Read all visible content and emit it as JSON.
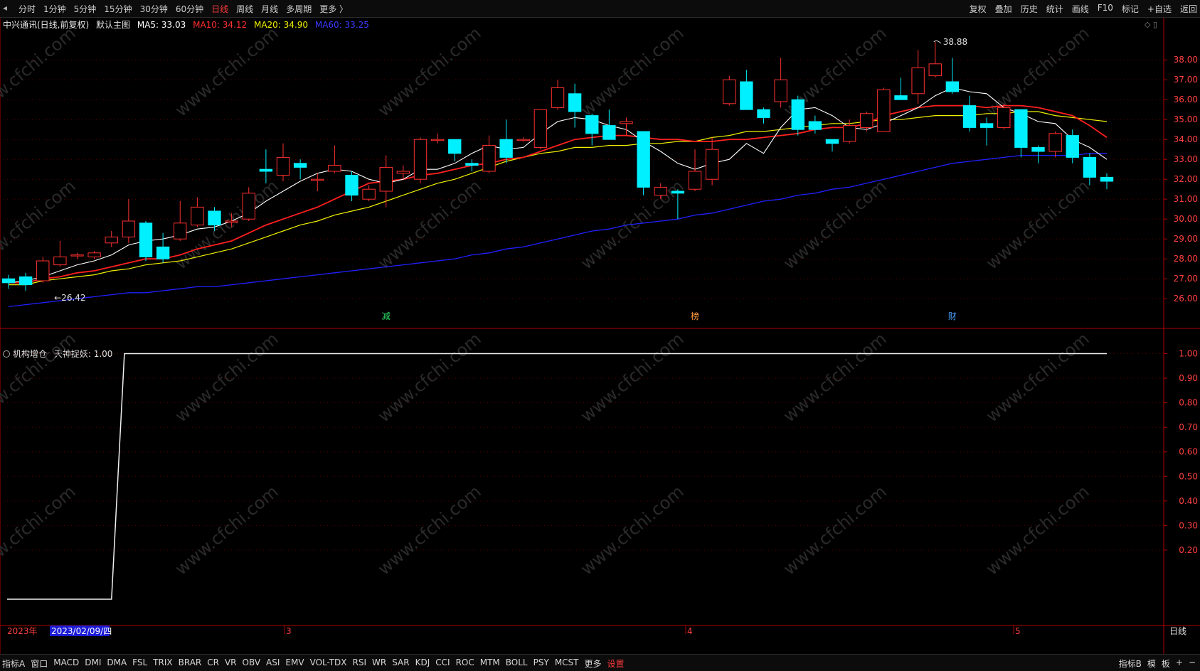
{
  "topbar": {
    "nav_arrow": "◂",
    "periods": [
      "分时",
      "1分钟",
      "5分钟",
      "15分钟",
      "30分钟",
      "60分钟",
      "日线",
      "周线",
      "月线",
      "多周期",
      "更多 〉"
    ],
    "active_period": "日线",
    "tools": [
      "复权",
      "叠加",
      "历史",
      "统计",
      "画线",
      "F10",
      "标记",
      "+自选",
      "返回"
    ]
  },
  "main_chart": {
    "stock_name": "中兴通讯(日线,前复权)",
    "template": "默认主图",
    "ma5_label": "MA5: 33.03",
    "ma10_label": "MA10: 34.12",
    "ma20_label": "MA20: 34.90",
    "ma60_label": "MA60: 33.25",
    "panel_icons": "◇ ▯",
    "high_annotation": "38.88",
    "low_annotation": "←26.42",
    "price_ticks": [
      "38.00",
      "37.00",
      "36.00",
      "35.00",
      "34.00",
      "33.00",
      "32.00",
      "31.00",
      "30.00",
      "29.00",
      "28.00",
      "27.00",
      "26.00"
    ],
    "markers": [
      {
        "text": "减",
        "color": "#2ee86a"
      },
      {
        "text": "榜",
        "color": "#ff9a3c"
      },
      {
        "text": "财",
        "color": "#4aa3ff"
      }
    ],
    "watermark": "www.cfchi.com",
    "colors": {
      "up": "#ff3030",
      "down": "#00f0ff",
      "ma5": "#ffffff",
      "ma10": "#ff2020",
      "ma20": "#f0f000",
      "ma60": "#2020ff",
      "axis": "#b00000"
    }
  },
  "sub_chart": {
    "name": "机构增仓",
    "indicator_label": "天神捉妖: 1.00",
    "ticks": [
      "1.00",
      "0.90",
      "0.80",
      "0.70",
      "0.60",
      "0.50",
      "0.40",
      "0.30",
      "0.20"
    ]
  },
  "date_axis": {
    "year_label": "2023年",
    "cursor_date": "2023/02/09/四",
    "month_labels": [
      "3",
      "4",
      "5"
    ],
    "period_badge": "日线"
  },
  "bottombar": {
    "indicators": [
      "指标A",
      "窗口",
      "MACD",
      "DMI",
      "DMA",
      "FSL",
      "TRIX",
      "BRAR",
      "CR",
      "VR",
      "OBV",
      "ASI",
      "EMV",
      "VOL-TDX",
      "RSI",
      "WR",
      "SAR",
      "KDJ",
      "CCI",
      "ROC",
      "MTM",
      "BOLL",
      "PSY",
      "MCST",
      "更多",
      "设置"
    ],
    "right_buttons": [
      "指标B",
      "模",
      "板",
      "+",
      "−"
    ]
  },
  "chart_data": {
    "type": "candlestick",
    "candles": [
      [
        27.0,
        26.8,
        27.2,
        26.5
      ],
      [
        27.1,
        26.7,
        27.3,
        26.4
      ],
      [
        26.9,
        27.9,
        28.1,
        26.8
      ],
      [
        27.7,
        28.1,
        28.9,
        27.6
      ],
      [
        28.2,
        28.2,
        28.3,
        28.0
      ],
      [
        28.1,
        28.3,
        28.4,
        28.0
      ],
      [
        28.8,
        29.1,
        29.4,
        28.6
      ],
      [
        29.1,
        29.9,
        31.0,
        28.8
      ],
      [
        29.8,
        28.1,
        29.9,
        27.9
      ],
      [
        28.6,
        28.0,
        29.3,
        27.8
      ],
      [
        29.0,
        29.8,
        30.9,
        28.9
      ],
      [
        29.7,
        30.6,
        31.1,
        29.6
      ],
      [
        30.4,
        29.7,
        30.6,
        29.4
      ],
      [
        29.9,
        29.9,
        30.3,
        29.6
      ],
      [
        30.0,
        31.3,
        31.6,
        29.9
      ],
      [
        32.5,
        32.4,
        33.5,
        31.8
      ],
      [
        32.2,
        33.1,
        33.8,
        31.9
      ],
      [
        32.8,
        32.6,
        33.0,
        32.0
      ],
      [
        32.0,
        32.0,
        32.3,
        31.4
      ],
      [
        32.4,
        32.7,
        33.7,
        32.3
      ],
      [
        32.2,
        31.2,
        32.4,
        30.9
      ],
      [
        31.0,
        31.5,
        31.7,
        30.9
      ],
      [
        31.4,
        32.6,
        33.2,
        30.6
      ],
      [
        32.3,
        32.4,
        32.7,
        32.0
      ],
      [
        32.0,
        34.0,
        34.1,
        31.8
      ],
      [
        34.0,
        34.0,
        34.3,
        33.8
      ],
      [
        34.0,
        33.3,
        34.0,
        32.9
      ],
      [
        32.8,
        32.7,
        33.0,
        32.4
      ],
      [
        32.4,
        33.7,
        34.2,
        32.3
      ],
      [
        34.0,
        33.1,
        35.0,
        32.8
      ],
      [
        34.0,
        34.0,
        34.1,
        33.9
      ],
      [
        33.6,
        35.5,
        35.5,
        33.5
      ],
      [
        35.6,
        36.6,
        37.0,
        35.5
      ],
      [
        36.3,
        35.4,
        36.8,
        34.6
      ],
      [
        35.2,
        34.3,
        35.3,
        33.7
      ],
      [
        34.7,
        34.0,
        35.5,
        34.0
      ],
      [
        34.8,
        34.9,
        35.1,
        34.2
      ],
      [
        34.4,
        31.6,
        34.4,
        31.2
      ],
      [
        31.2,
        31.6,
        31.8,
        31.0
      ],
      [
        31.4,
        31.3,
        31.5,
        30.0
      ],
      [
        31.5,
        32.4,
        33.5,
        31.4
      ],
      [
        32.0,
        33.5,
        34.1,
        31.7
      ],
      [
        35.8,
        37.0,
        37.2,
        35.7
      ],
      [
        36.9,
        35.5,
        37.5,
        35.5
      ],
      [
        35.5,
        35.1,
        35.6,
        34.8
      ],
      [
        35.9,
        37.0,
        38.1,
        35.6
      ],
      [
        36.0,
        34.5,
        36.2,
        34.2
      ],
      [
        34.9,
        34.5,
        35.2,
        34.3
      ],
      [
        34.0,
        33.8,
        34.0,
        33.4
      ],
      [
        33.9,
        34.7,
        35.0,
        33.8
      ],
      [
        34.6,
        35.3,
        35.4,
        34.4
      ],
      [
        34.4,
        36.5,
        36.6,
        34.5
      ],
      [
        36.2,
        36.0,
        37.1,
        36.0
      ],
      [
        36.3,
        37.6,
        38.5,
        35.8
      ],
      [
        37.2,
        37.8,
        38.9,
        37.1
      ],
      [
        36.9,
        36.4,
        38.1,
        36.3
      ],
      [
        35.7,
        34.6,
        36.2,
        34.4
      ],
      [
        34.8,
        34.6,
        35.1,
        33.7
      ],
      [
        34.6,
        35.6,
        35.8,
        34.5
      ],
      [
        35.5,
        33.6,
        35.5,
        33.1
      ],
      [
        33.6,
        33.4,
        33.7,
        32.8
      ],
      [
        33.4,
        34.3,
        34.4,
        33.1
      ],
      [
        34.2,
        33.1,
        34.5,
        32.8
      ],
      [
        33.1,
        32.1,
        33.3,
        31.7
      ],
      [
        32.1,
        31.9,
        32.3,
        31.5
      ]
    ],
    "ma5": [
      26.8,
      26.9,
      27.1,
      27.4,
      27.7,
      27.9,
      28.2,
      28.7,
      28.9,
      29.0,
      29.2,
      29.5,
      29.6,
      29.9,
      30.3,
      30.9,
      31.4,
      31.9,
      32.3,
      32.5,
      32.4,
      32.0,
      31.8,
      32.0,
      32.5,
      32.5,
      32.8,
      33.3,
      33.7,
      33.5,
      33.6,
      34.3,
      34.9,
      35.1,
      35.0,
      34.7,
      34.5,
      33.9,
      33.4,
      32.8,
      32.5,
      32.8,
      33.0,
      33.8,
      33.3,
      34.6,
      35.5,
      35.6,
      35.2,
      34.6,
      34.5,
      34.8,
      35.2,
      35.6,
      36.2,
      36.6,
      36.4,
      36.3,
      35.6,
      35.3,
      34.9,
      34.8,
      34.0,
      33.6,
      33.0
    ],
    "ma10": [
      26.8,
      26.8,
      27.0,
      27.1,
      27.3,
      27.4,
      27.6,
      27.8,
      28.0,
      28.0,
      28.2,
      28.5,
      28.7,
      28.9,
      29.3,
      29.7,
      30.0,
      30.3,
      30.6,
      31.0,
      31.4,
      31.8,
      31.9,
      32.0,
      32.2,
      32.3,
      32.5,
      32.7,
      32.8,
      33.0,
      33.1,
      33.4,
      33.7,
      34.0,
      34.1,
      34.2,
      34.2,
      34.1,
      34.0,
      34.0,
      33.9,
      33.9,
      34.0,
      34.0,
      34.1,
      34.2,
      34.3,
      34.5,
      34.6,
      34.6,
      34.8,
      35.2,
      35.4,
      35.6,
      35.7,
      35.7,
      35.7,
      35.6,
      35.7,
      35.7,
      35.6,
      35.4,
      35.2,
      34.7,
      34.1
    ],
    "ma20": [
      26.7,
      26.7,
      26.9,
      27.0,
      27.1,
      27.2,
      27.4,
      27.5,
      27.7,
      27.8,
      27.9,
      28.1,
      28.3,
      28.5,
      28.8,
      29.1,
      29.4,
      29.7,
      29.9,
      30.2,
      30.4,
      30.6,
      30.9,
      31.2,
      31.5,
      31.8,
      32.0,
      32.3,
      32.6,
      32.9,
      33.1,
      33.3,
      33.4,
      33.6,
      33.6,
      33.7,
      33.7,
      33.8,
      33.8,
      33.9,
      33.9,
      34.1,
      34.2,
      34.4,
      34.4,
      34.5,
      34.6,
      34.7,
      34.8,
      34.8,
      34.9,
      35.0,
      35.0,
      35.1,
      35.2,
      35.2,
      35.2,
      35.3,
      35.3,
      35.4,
      35.4,
      35.2,
      35.1,
      35.0,
      34.9
    ],
    "ma60": [
      25.6,
      25.7,
      25.8,
      25.9,
      26.0,
      26.1,
      26.2,
      26.3,
      26.3,
      26.4,
      26.5,
      26.6,
      26.6,
      26.7,
      26.8,
      26.9,
      27.0,
      27.1,
      27.2,
      27.3,
      27.4,
      27.5,
      27.6,
      27.7,
      27.8,
      27.9,
      28.0,
      28.2,
      28.3,
      28.5,
      28.6,
      28.8,
      29.0,
      29.2,
      29.4,
      29.5,
      29.7,
      29.8,
      29.9,
      30.0,
      30.2,
      30.3,
      30.5,
      30.7,
      30.9,
      31.0,
      31.2,
      31.3,
      31.5,
      31.6,
      31.8,
      32.0,
      32.2,
      32.4,
      32.6,
      32.8,
      32.9,
      33.0,
      33.1,
      33.2,
      33.2,
      33.2,
      33.2,
      33.3,
      33.3
    ],
    "ylim": [
      25.4,
      39.4
    ],
    "sub_series": {
      "name": "机构增仓",
      "step_index": 7,
      "before": 0.0,
      "after": 1.0
    },
    "sub_ylim": [
      0.0,
      1.1
    ]
  }
}
